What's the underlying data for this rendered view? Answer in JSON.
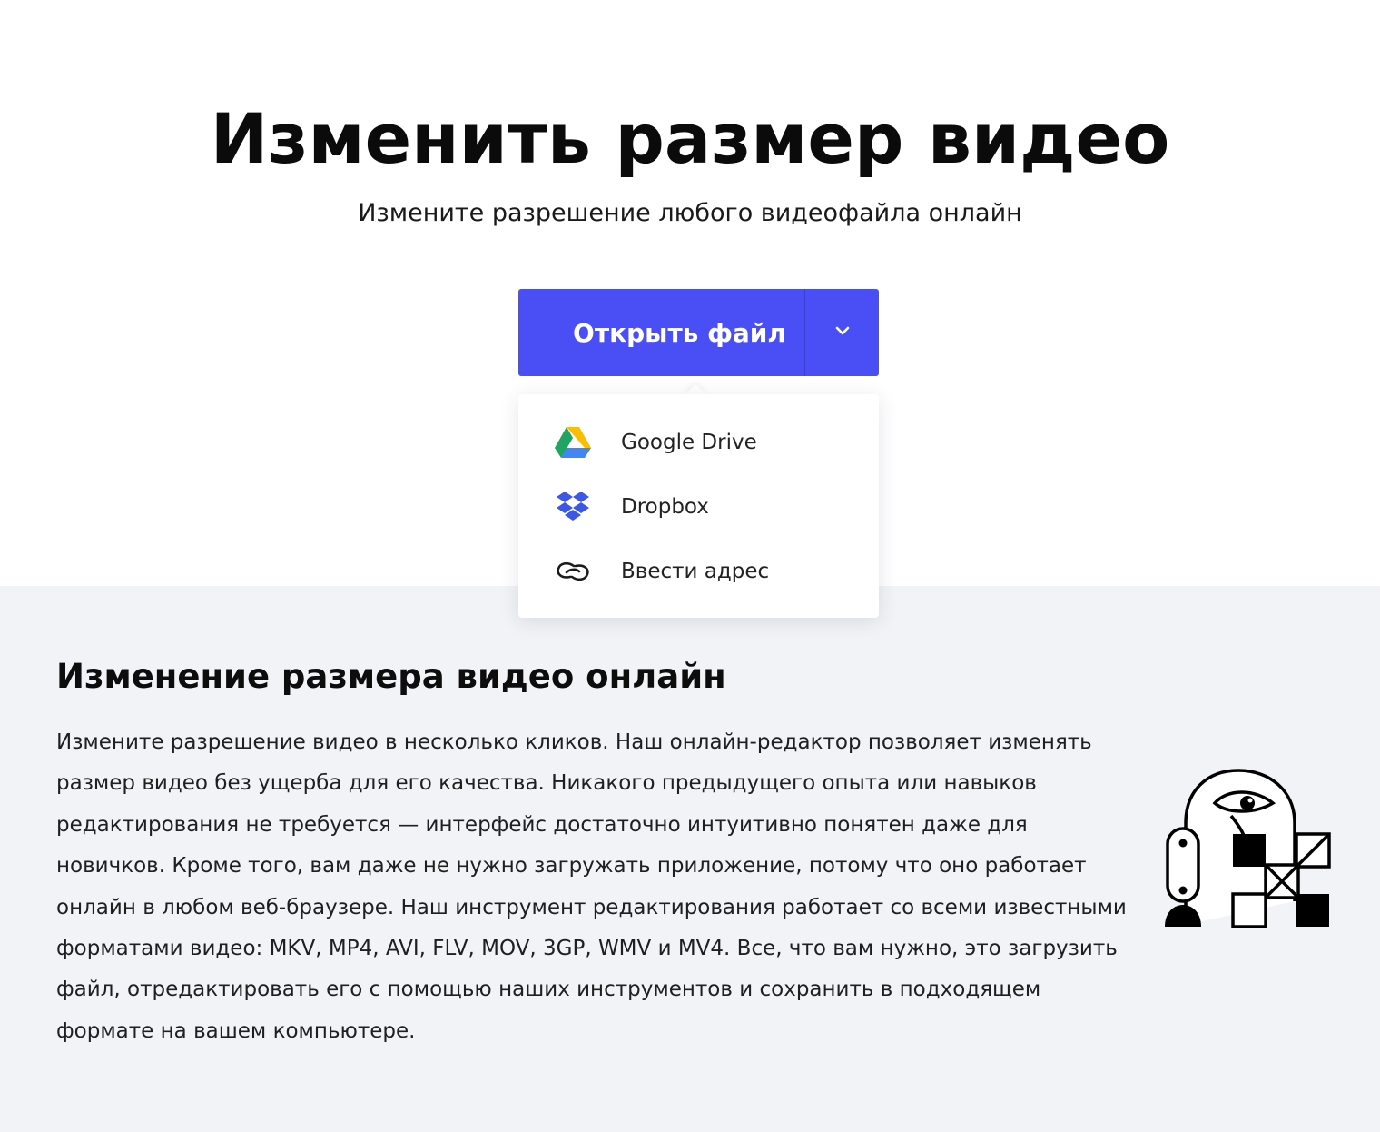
{
  "hero": {
    "title": "Изменить размер видео",
    "subtitle": "Измените разрешение любого видеофайла онлайн"
  },
  "open_button": {
    "label": "Открыть файл",
    "toggle_icon": "chevron-down-icon",
    "color": "#4a4ff5"
  },
  "dropdown": {
    "items": [
      {
        "label": "Google Drive",
        "icon": "google-drive-icon"
      },
      {
        "label": "Dropbox",
        "icon": "dropbox-icon"
      },
      {
        "label": "Ввести адрес",
        "icon": "link-icon"
      }
    ]
  },
  "info": {
    "title": "Изменение размера видео онлайн",
    "body": "Измените разрешение видео в несколько кликов. Наш онлайн-редактор позволяет изменять размер видео без ущерба для его качества. Никакого предыдущего опыта или навыков редактирования не требуется — интерфейс достаточно интуитивно понятен даже для новичков. Кроме того, вам даже не нужно загружать приложение, потому что оно работает онлайн в любом веб-браузере. Наш инструмент редактирования работает со всеми известными форматами видео: MKV, MP4, AVI, FLV, MOV, 3GP, WMV и MV4. Все, что вам нужно, это загрузить файл, отредактировать его с помощью наших инструментов и сохранить в подходящем формате на вашем компьютере.",
    "illustration_icon": "robot-illustration"
  }
}
